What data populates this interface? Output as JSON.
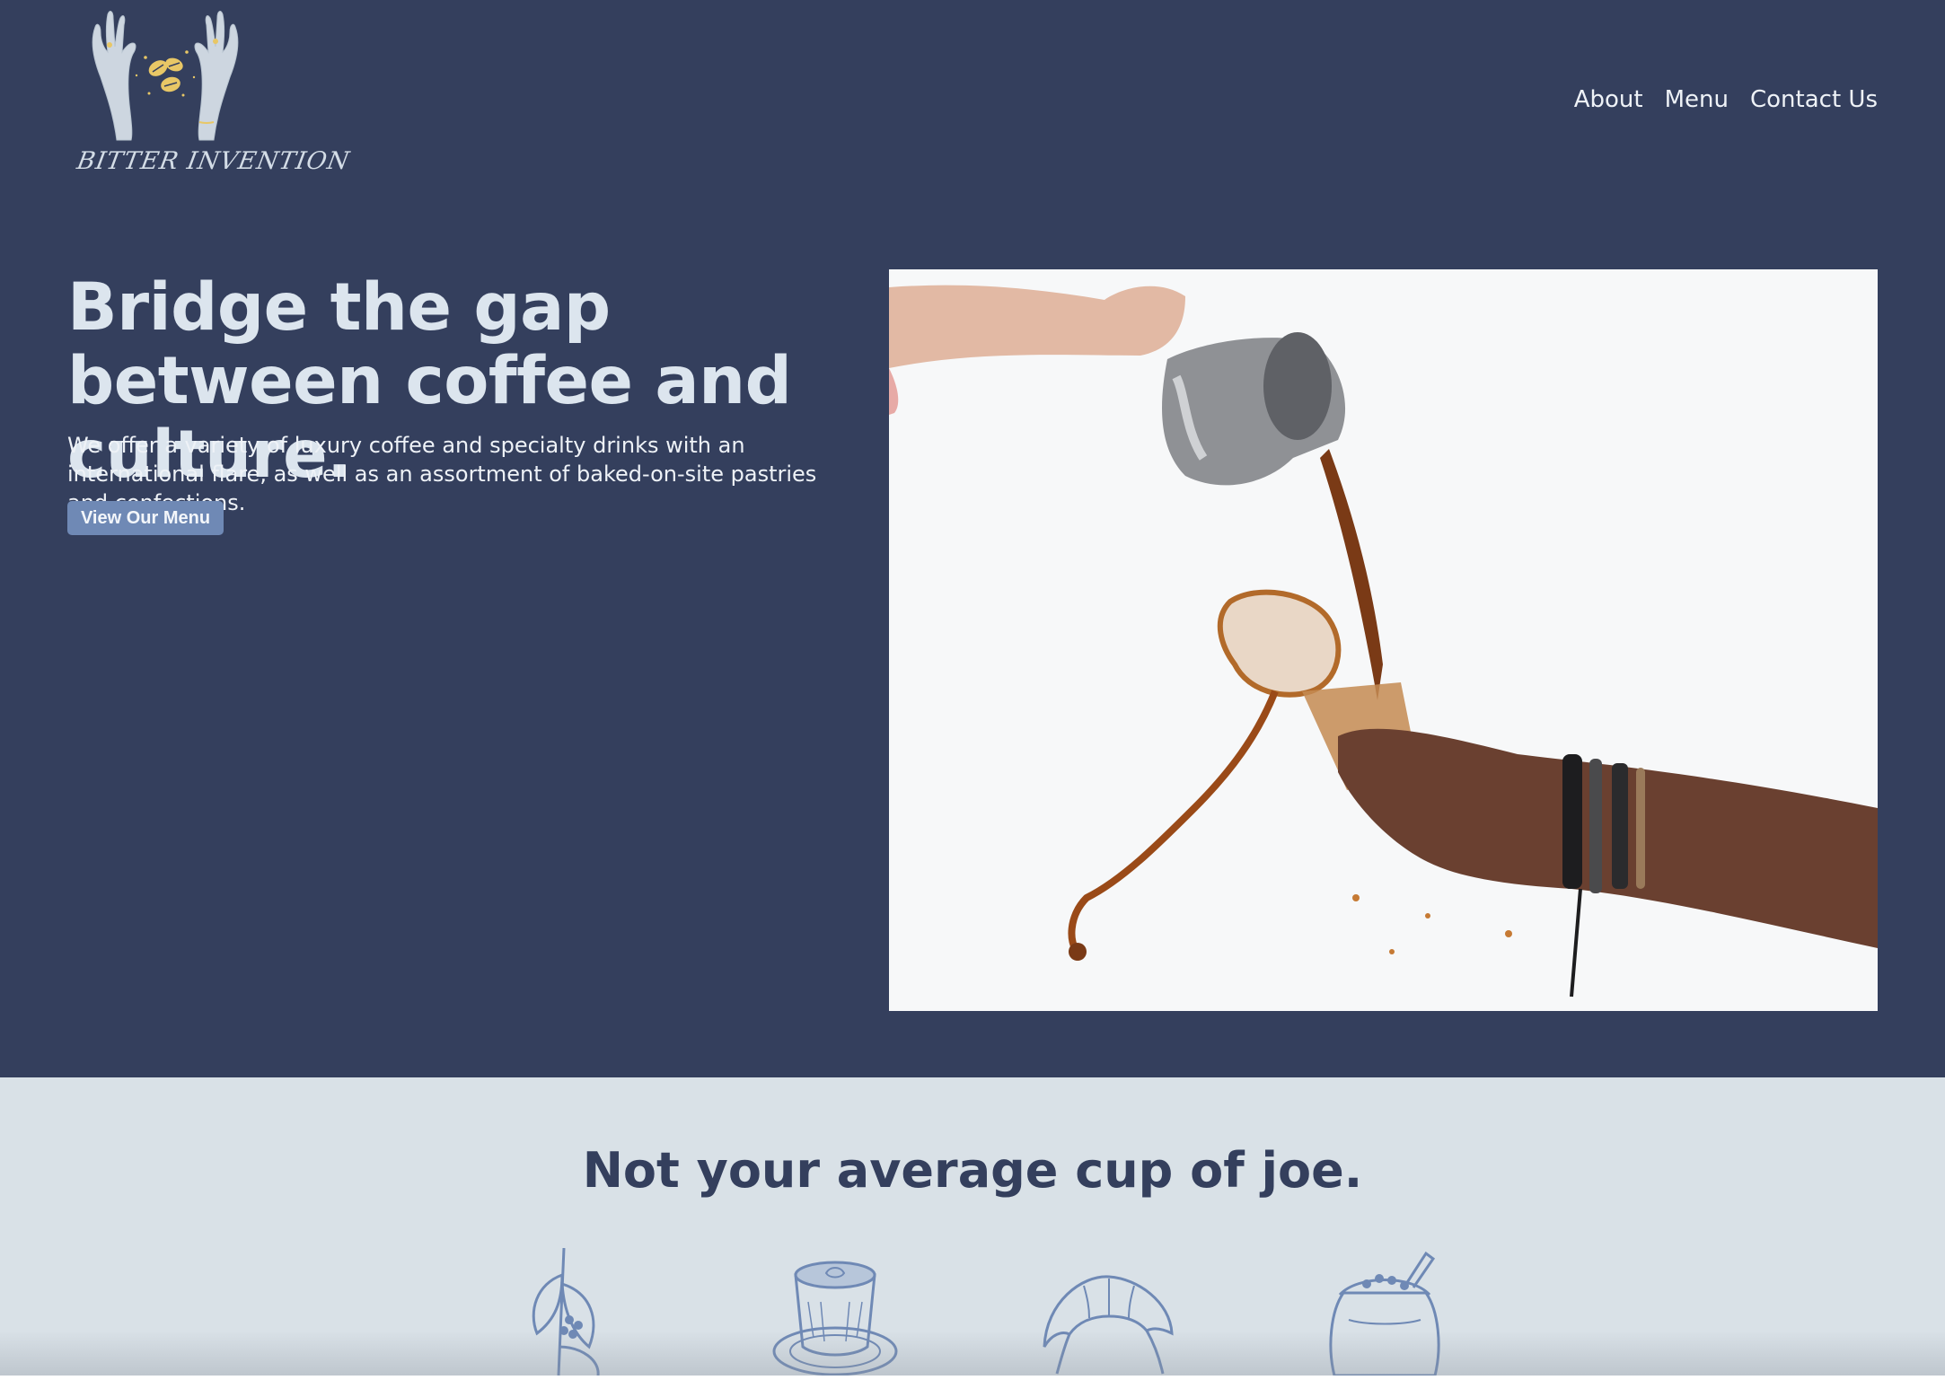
{
  "brand": {
    "logo_text": "BITTER INVENTION",
    "logo_icon": "hands-with-coffee-beans-icon"
  },
  "nav": {
    "items": [
      "About",
      "Menu",
      "Contact Us"
    ]
  },
  "hero": {
    "headline": "Bridge the gap between coffee and culture.",
    "subtext": "We offer a variety of luxury coffee and specialty drinks with an international flare, as well as an assortment of baked-on-site pastries and confections.",
    "cta_label": "View Our Menu",
    "photo": "coffee-pour-photo"
  },
  "features": {
    "heading": "Not your average cup of joe.",
    "illustrations": [
      "coffee-plant-icon",
      "latte-cup-icon",
      "croissant-icon",
      "coffee-bean-sack-icon"
    ]
  },
  "colors": {
    "hero_bg": "#343f5d",
    "section_bg": "#d9e1e7",
    "button_bg": "#6f89b5",
    "heading_light": "#dce5ee",
    "heading_dark": "#343f5d",
    "illustration": "#6f89b5",
    "logo_accent": "#e8c766"
  }
}
